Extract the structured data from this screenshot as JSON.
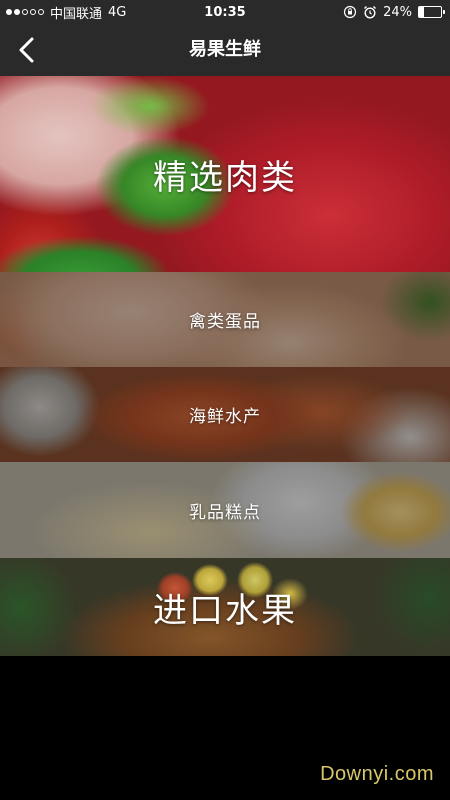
{
  "status_bar": {
    "carrier": "中国联通",
    "network": "4G",
    "time": "10:35",
    "battery_percent": "24%",
    "battery_level": 0.24,
    "signal_bars": [
      true,
      true,
      false,
      false,
      false
    ]
  },
  "nav": {
    "title": "易果生鲜",
    "back_icon": "chevron-left-icon"
  },
  "categories": [
    {
      "label": "精选肉类"
    },
    {
      "label": "禽类蛋品"
    },
    {
      "label": "海鲜水产"
    },
    {
      "label": "乳品糕点"
    },
    {
      "label": "进口水果"
    }
  ],
  "watermark": "Downyi.com"
}
